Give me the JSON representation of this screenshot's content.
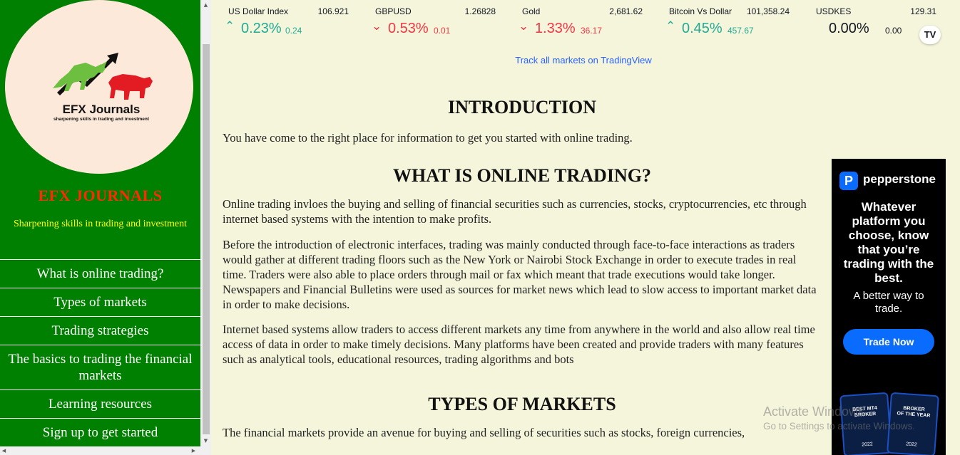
{
  "sidebar": {
    "logo_title": "EFX Journals",
    "logo_tagline": "sharpening skills in trading and investment",
    "brand": "EFX JOURNALS",
    "tagline": "Sharpening skills in trading and investment",
    "nav": [
      "What is online trading?",
      "Types of markets",
      "Trading strategies",
      "The basics to trading the financial markets",
      "Learning resources",
      "Sign up to get started"
    ]
  },
  "ticker": {
    "items": [
      {
        "name": "US Dollar Index",
        "price": "106.921",
        "direction": "up",
        "pct": "0.23%",
        "change": "0.24"
      },
      {
        "name": "GBPUSD",
        "price": "1.26828",
        "direction": "down",
        "pct": "0.53%",
        "change": "0.01"
      },
      {
        "name": "Gold",
        "price": "2,681.62",
        "direction": "down",
        "pct": "1.33%",
        "change": "36.17"
      },
      {
        "name": "Bitcoin Vs Dollar",
        "price": "101,358.24",
        "direction": "up",
        "pct": "0.45%",
        "change": "457.67"
      },
      {
        "name": "USDKES",
        "price": "129.31",
        "direction": "flat",
        "pct": "0.00%",
        "change": "0.00"
      }
    ],
    "logo": "TV",
    "track_link": "Track all markets on TradingView"
  },
  "content": {
    "intro_heading": "INTRODUCTION",
    "intro_text": "You have come to the right place for information to get you started with online trading.",
    "what_heading": "WHAT IS ONLINE TRADING?",
    "what_p1": "Online trading invloes the buying and selling of financial securities such as currencies, stocks, cryptocurrencies, etc through internet based systems with the intention to make profits.",
    "what_p2": "Before the introduction of electronic interfaces, trading was mainly conducted through face-to-face interactions as traders would gather at different trading floors such as the New York or Nairobi Stock Exchange in order to execute trades in real time. Traders were also able to place orders through mail or fax which meant that trade executions would take longer. Newspapers and Financial Bulletins were used as sources for market news which lead to slow access to important market data in order to make decisions.",
    "what_p3": "Internet based systems allow traders to access different markets any time from anywhere in the world and also allow real time access of data in order to make timely decisions. Many platforms have been created and provide traders with many features such as analytical tools, educational resources, trading algorithms and bots",
    "types_heading": "TYPES OF MARKETS",
    "types_text": "The financial markets provide an avenue for buying and selling of securities such as stocks, foreign currencies,"
  },
  "ad": {
    "brand": "pepperstone",
    "headline": "Whatever platform you choose, know that you’re trading with the best.",
    "sub": "A better way to trade.",
    "cta": "Trade Now",
    "badge1_line1": "BEST MT4",
    "badge1_line2": "BROKER",
    "badge1_year": "2022",
    "badge2_line1": "BROKER",
    "badge2_line2": "OF THE YEAR",
    "badge2_year": "2022"
  },
  "watermark": {
    "title": "Activate Windows",
    "sub": "Go to Settings to activate Windows."
  },
  "colors": {
    "sidebar_bg": "#008000",
    "brand_red": "#ff2a00",
    "tagline_yellow": "#ffff00",
    "page_bg": "#f5f5dc",
    "up": "#22ab94",
    "down": "#f23645",
    "link": "#2962ff",
    "ad_blue": "#0a6cff"
  }
}
